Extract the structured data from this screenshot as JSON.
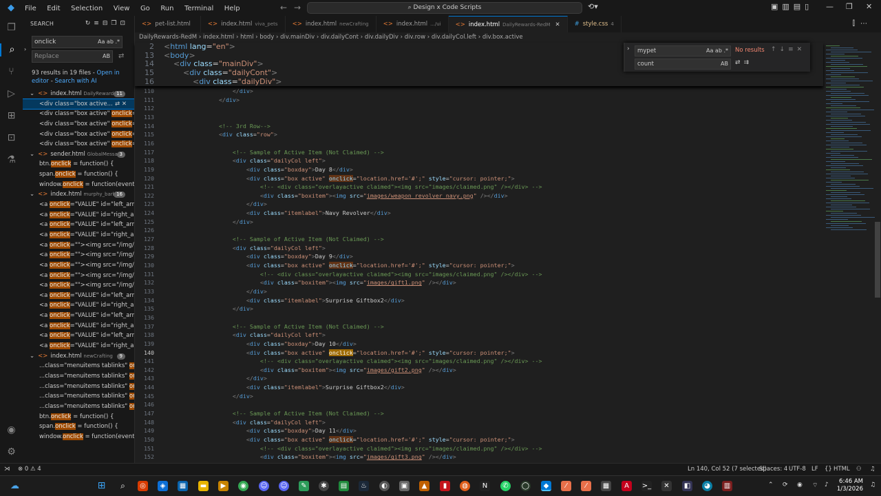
{
  "menu": [
    "File",
    "Edit",
    "Selection",
    "View",
    "Go",
    "Run",
    "Terminal",
    "Help"
  ],
  "command_center": "Design x Code Scripts",
  "sidebar": {
    "title": "SEARCH",
    "search_value": "onclick",
    "replace_placeholder": "Replace",
    "result_summary": "93 results in 19 files - ",
    "open_editor_link": "Open in editor",
    "search_ai_link": "Search with AI",
    "tree": [
      {
        "kind": "file",
        "name": "index.html",
        "dir": "DailyRewards-...",
        "count": "11"
      },
      {
        "kind": "match",
        "pre": "<div class=\"box active...",
        "hit": "",
        "post": "",
        "selected": true
      },
      {
        "kind": "match",
        "pre": "<div class=\"box active\" ",
        "hit": "onclick",
        "post": "=..."
      },
      {
        "kind": "match",
        "pre": "<div class=\"box active\" ",
        "hit": "onclick",
        "post": "=..."
      },
      {
        "kind": "match",
        "pre": "<div class=\"box active\" ",
        "hit": "onclick",
        "post": "=..."
      },
      {
        "kind": "match",
        "pre": "<div class=\"box active\" ",
        "hit": "onclick",
        "post": "=..."
      },
      {
        "kind": "file",
        "name": "sender.html",
        "dir": "GlobalMessage",
        "count": "3"
      },
      {
        "kind": "match",
        "pre": "btn.",
        "hit": "onclick",
        "post": " = function() {"
      },
      {
        "kind": "match",
        "pre": "span.",
        "hit": "onclick",
        "post": " = function() {"
      },
      {
        "kind": "match",
        "pre": "window.",
        "hit": "onclick",
        "post": " = function(event) {"
      },
      {
        "kind": "file",
        "name": "index.html",
        "dir": "murphy_barbe...",
        "count": "16"
      },
      {
        "kind": "match",
        "pre": "<a ",
        "hit": "onclick",
        "post": "=\"VALUE\" id=\"left_arro..."
      },
      {
        "kind": "match",
        "pre": "<a ",
        "hit": "onclick",
        "post": "=\"VALUE\" id=\"right_ar..."
      },
      {
        "kind": "match",
        "pre": "<a ",
        "hit": "onclick",
        "post": "=\"VALUE\" id=\"left_arro..."
      },
      {
        "kind": "match",
        "pre": "<a ",
        "hit": "onclick",
        "post": "=\"VALUE\" id=\"right_ar..."
      },
      {
        "kind": "match",
        "pre": "<a ",
        "hit": "onclick",
        "post": "=\"\"><img src=\"/img/..."
      },
      {
        "kind": "match",
        "pre": "<a ",
        "hit": "onclick",
        "post": "=\"\"><img src=\"/img/..."
      },
      {
        "kind": "match",
        "pre": "<a ",
        "hit": "onclick",
        "post": "=\"\"><img src=\"/img/..."
      },
      {
        "kind": "match",
        "pre": "<a ",
        "hit": "onclick",
        "post": "=\"\"><img src=\"/img/..."
      },
      {
        "kind": "match",
        "pre": "<a ",
        "hit": "onclick",
        "post": "=\"\"><img src=\"/img/..."
      },
      {
        "kind": "match",
        "pre": "<a ",
        "hit": "onclick",
        "post": "=\"VALUE\" id=\"left_arro..."
      },
      {
        "kind": "match",
        "pre": "<a ",
        "hit": "onclick",
        "post": "=\"VALUE\" id=\"right_ar..."
      },
      {
        "kind": "match",
        "pre": "<a ",
        "hit": "onclick",
        "post": "=\"VALUE\" id=\"left_arro..."
      },
      {
        "kind": "match",
        "pre": "<a ",
        "hit": "onclick",
        "post": "=\"VALUE\" id=\"right_ar..."
      },
      {
        "kind": "match",
        "pre": "<a ",
        "hit": "onclick",
        "post": "=\"VALUE\" id=\"left_arro..."
      },
      {
        "kind": "match",
        "pre": "<a ",
        "hit": "onclick",
        "post": "=\"VALUE\" id=\"right_ar..."
      },
      {
        "kind": "file",
        "name": "index.html",
        "dir": "newCrafting",
        "count": "9"
      },
      {
        "kind": "match",
        "pre": "...class=\"menuitems tablinks\" ",
        "hit": "on...",
        "post": ""
      },
      {
        "kind": "match",
        "pre": "...class=\"menuitems tablinks\" ",
        "hit": "on...",
        "post": ""
      },
      {
        "kind": "match",
        "pre": "...class=\"menuitems tablinks\" ",
        "hit": "on...",
        "post": ""
      },
      {
        "kind": "match",
        "pre": "...class=\"menuitems tablinks\" ",
        "hit": "on...",
        "post": ""
      },
      {
        "kind": "match",
        "pre": "...class=\"menuitems tablinks\" ",
        "hit": "on...",
        "post": ""
      },
      {
        "kind": "match",
        "pre": "btn.",
        "hit": "onclick",
        "post": " = function() {"
      },
      {
        "kind": "match",
        "pre": "span.",
        "hit": "onclick",
        "post": " = function() {"
      },
      {
        "kind": "match",
        "pre": "window.",
        "hit": "onclick",
        "post": " = function(event) {"
      }
    ]
  },
  "tabs": [
    {
      "name": "pet-list.html",
      "dir": "",
      "kind": "html",
      "active": false
    },
    {
      "name": "index.html",
      "dir": "viva_pets",
      "kind": "html",
      "active": false
    },
    {
      "name": "index.html",
      "dir": "newCrafting",
      "kind": "html",
      "active": false
    },
    {
      "name": "index.html",
      "dir": ".../ui",
      "kind": "html",
      "active": false
    },
    {
      "name": "index.html",
      "dir": "DailyRewards-RedM",
      "kind": "html",
      "active": true
    },
    {
      "name": "style.css",
      "dir": "4",
      "kind": "css",
      "active": false
    }
  ],
  "breadcrumb": [
    "DailyRewards-RedM",
    "index.html",
    "html",
    "body",
    "div.mainDiv",
    "div.dailyCont",
    "div.dailyDiv",
    "div.row",
    "div.dailyCol.left",
    "div.box.active"
  ],
  "find_widget": {
    "find_value": "mypet",
    "find_opts": "Aa ab .*",
    "no_results": "No results",
    "replace_value": "count"
  },
  "sticky_lines": [
    {
      "n": "2",
      "html": "<span class=\"p\">&lt;</span><span class=\"t\">html</span> <span class=\"a\">lang</span>=<span class=\"s\">\"en\"</span><span class=\"p\">&gt;</span>"
    },
    {
      "n": "13",
      "html": "<span class=\"p\">&lt;</span><span class=\"t\">body</span><span class=\"p\">&gt;</span>"
    },
    {
      "n": "14",
      "html": "    <span class=\"p\">&lt;</span><span class=\"t\">div</span> <span class=\"a\">class</span>=<span class=\"s\">\"mainDiv\"</span><span class=\"p\">&gt;</span>"
    },
    {
      "n": "15",
      "html": "        <span class=\"p\">&lt;</span><span class=\"t\">div</span> <span class=\"a\">class</span>=<span class=\"s\">\"dailyCont\"</span><span class=\"p\">&gt;</span>"
    },
    {
      "n": "16",
      "html": "            <span class=\"p\">&lt;</span><span class=\"t\">div</span> <span class=\"a\">class</span>=<span class=\"s\">\"dailyDiv\"</span><span class=\"p\">&gt;</span>"
    }
  ],
  "code_lines": [
    {
      "n": "110",
      "html": "                    <span class=\"p\">&lt;/</span><span class=\"t\">div</span><span class=\"p\">&gt;</span>"
    },
    {
      "n": "111",
      "html": "                <span class=\"p\">&lt;/</span><span class=\"t\">div</span><span class=\"p\">&gt;</span>"
    },
    {
      "n": "112",
      "html": ""
    },
    {
      "n": "113",
      "html": ""
    },
    {
      "n": "114",
      "html": "                <span class=\"c\">&lt;!-- 3rd Row--&gt;</span>"
    },
    {
      "n": "115",
      "html": "                <span class=\"p\">&lt;</span><span class=\"t\">div</span> <span class=\"a\">class</span>=<span class=\"s\">\"row\"</span><span class=\"p\">&gt;</span>"
    },
    {
      "n": "116",
      "html": ""
    },
    {
      "n": "117",
      "html": "                    <span class=\"c\">&lt;!-- Sample of Active Item (Not Claimed) --&gt;</span>"
    },
    {
      "n": "118",
      "html": "                    <span class=\"p\">&lt;</span><span class=\"t\">div</span> <span class=\"a\">class</span>=<span class=\"s\">\"dailyCol left\"</span><span class=\"p\">&gt;</span>"
    },
    {
      "n": "119",
      "html": "                        <span class=\"p\">&lt;</span><span class=\"t\">div</span> <span class=\"a\">class</span>=<span class=\"s\">\"boxday\"</span><span class=\"p\">&gt;</span><span class=\"w\">Day 8</span><span class=\"p\">&lt;/</span><span class=\"t\">div</span><span class=\"p\">&gt;</span>"
    },
    {
      "n": "120",
      "html": "                        <span class=\"p\">&lt;</span><span class=\"t\">div</span> <span class=\"a\">class</span>=<span class=\"s\">\"box active\"</span> <span class=\"a m\">onclick</span>=<span class=\"s\">\"location.href='#';\"</span> <span class=\"a\">style</span>=<span class=\"s\">\"cursor: pointer;\"</span><span class=\"p\">&gt;</span>"
    },
    {
      "n": "121",
      "html": "                            <span class=\"c\">&lt;!-- &lt;div class=\"overlayactive claimed\"&gt;&lt;img src=\"images/claimed.png\" /&gt;&lt;/div&gt; --&gt;</span>"
    },
    {
      "n": "122",
      "html": "                            <span class=\"p\">&lt;</span><span class=\"t\">div</span> <span class=\"a\">class</span>=<span class=\"s\">\"boxitem\"</span><span class=\"p\">&gt;&lt;</span><span class=\"t\">img</span> <span class=\"a\">src</span>=<span class=\"s\">\"<span class=\"u\">images/weapon_revolver_navy.png</span>\"</span> <span class=\"p\">/&gt;&lt;/</span><span class=\"t\">div</span><span class=\"p\">&gt;</span>"
    },
    {
      "n": "123",
      "html": "                        <span class=\"p\">&lt;/</span><span class=\"t\">div</span><span class=\"p\">&gt;</span>"
    },
    {
      "n": "124",
      "html": "                        <span class=\"p\">&lt;</span><span class=\"t\">div</span> <span class=\"a\">class</span>=<span class=\"s\">\"itemlabel\"</span><span class=\"p\">&gt;</span><span class=\"w\">Navy Revolver</span><span class=\"p\">&lt;/</span><span class=\"t\">div</span><span class=\"p\">&gt;</span>"
    },
    {
      "n": "125",
      "html": "                    <span class=\"p\">&lt;/</span><span class=\"t\">div</span><span class=\"p\">&gt;</span>"
    },
    {
      "n": "126",
      "html": ""
    },
    {
      "n": "127",
      "html": "                    <span class=\"c\">&lt;!-- Sample of Active Item (Not Claimed) --&gt;</span>"
    },
    {
      "n": "128",
      "html": "                    <span class=\"p\">&lt;</span><span class=\"t\">div</span> <span class=\"a\">class</span>=<span class=\"s\">\"dailyCol left\"</span><span class=\"p\">&gt;</span>"
    },
    {
      "n": "129",
      "html": "                        <span class=\"p\">&lt;</span><span class=\"t\">div</span> <span class=\"a\">class</span>=<span class=\"s\">\"boxday\"</span><span class=\"p\">&gt;</span><span class=\"w\">Day 9</span><span class=\"p\">&lt;/</span><span class=\"t\">div</span><span class=\"p\">&gt;</span>"
    },
    {
      "n": "130",
      "html": "                        <span class=\"p\">&lt;</span><span class=\"t\">div</span> <span class=\"a\">class</span>=<span class=\"s\">\"box active\"</span> <span class=\"a m\">onclick</span>=<span class=\"s\">\"location.href='#';\"</span> <span class=\"a\">style</span>=<span class=\"s\">\"cursor: pointer;\"</span><span class=\"p\">&gt;</span>"
    },
    {
      "n": "131",
      "html": "                            <span class=\"c\">&lt;!-- &lt;div class=\"overlayactive claimed\"&gt;&lt;img src=\"images/claimed.png\" /&gt;&lt;/div&gt; --&gt;</span>"
    },
    {
      "n": "132",
      "html": "                            <span class=\"p\">&lt;</span><span class=\"t\">div</span> <span class=\"a\">class</span>=<span class=\"s\">\"boxitem\"</span><span class=\"p\">&gt;&lt;</span><span class=\"t\">img</span> <span class=\"a\">src</span>=<span class=\"s\">\"<span class=\"u\">images/gift1.png</span>\"</span> <span class=\"p\">/&gt;&lt;/</span><span class=\"t\">div</span><span class=\"p\">&gt;</span>"
    },
    {
      "n": "133",
      "html": "                        <span class=\"p\">&lt;/</span><span class=\"t\">div</span><span class=\"p\">&gt;</span>"
    },
    {
      "n": "134",
      "html": "                        <span class=\"p\">&lt;</span><span class=\"t\">div</span> <span class=\"a\">class</span>=<span class=\"s\">\"itemlabel\"</span><span class=\"p\">&gt;</span><span class=\"w\">Surprise Giftbox2</span><span class=\"p\">&lt;/</span><span class=\"t\">div</span><span class=\"p\">&gt;</span>"
    },
    {
      "n": "135",
      "html": "                    <span class=\"p\">&lt;/</span><span class=\"t\">div</span><span class=\"p\">&gt;</span>"
    },
    {
      "n": "136",
      "html": ""
    },
    {
      "n": "137",
      "html": "                    <span class=\"c\">&lt;!-- Sample of Active Item (Not Claimed) --&gt;</span>"
    },
    {
      "n": "138",
      "html": "                    <span class=\"p\">&lt;</span><span class=\"t\">div</span> <span class=\"a\">class</span>=<span class=\"s\">\"dailyCol left\"</span><span class=\"p\">&gt;</span>"
    },
    {
      "n": "139",
      "html": "                        <span class=\"p\">&lt;</span><span class=\"t\">div</span> <span class=\"a\">class</span>=<span class=\"s\">\"boxday\"</span><span class=\"p\">&gt;</span><span class=\"w\">Day 10</span><span class=\"p\">&lt;/</span><span class=\"t\">div</span><span class=\"p\">&gt;</span>"
    },
    {
      "n": "140",
      "cur": true,
      "html": "                        <span class=\"p\">&lt;</span><span class=\"t\">div</span> <span class=\"a\">class</span>=<span class=\"s\">\"box active\"</span> <span class=\"mc\">onclick</span>=<span class=\"s\">\"location.href='#';\"</span> <span class=\"a\">style</span>=<span class=\"s\">\"cursor: pointer;\"</span><span class=\"p\">&gt;</span>"
    },
    {
      "n": "141",
      "html": "                            <span class=\"c\">&lt;!-- &lt;div class=\"overlayactive claimed\"&gt;&lt;img src=\"images/claimed.png\" /&gt;&lt;/div&gt; --&gt;</span>"
    },
    {
      "n": "142",
      "html": "                            <span class=\"p\">&lt;</span><span class=\"t\">div</span> <span class=\"a\">class</span>=<span class=\"s\">\"boxitem\"</span><span class=\"p\">&gt;&lt;</span><span class=\"t\">img</span> <span class=\"a\">src</span>=<span class=\"s\">\"<span class=\"u\">images/gift2.png</span>\"</span> <span class=\"p\">/&gt;&lt;/</span><span class=\"t\">div</span><span class=\"p\">&gt;</span>"
    },
    {
      "n": "143",
      "html": "                        <span class=\"p\">&lt;/</span><span class=\"t\">div</span><span class=\"p\">&gt;</span>"
    },
    {
      "n": "144",
      "html": "                        <span class=\"p\">&lt;</span><span class=\"t\">div</span> <span class=\"a\">class</span>=<span class=\"s\">\"itemlabel\"</span><span class=\"p\">&gt;</span><span class=\"w\">Surprise Giftbox2</span><span class=\"p\">&lt;/</span><span class=\"t\">div</span><span class=\"p\">&gt;</span>"
    },
    {
      "n": "145",
      "html": "                    <span class=\"p\">&lt;/</span><span class=\"t\">div</span><span class=\"p\">&gt;</span>"
    },
    {
      "n": "146",
      "html": ""
    },
    {
      "n": "147",
      "html": "                    <span class=\"c\">&lt;!-- Sample of Active Item (Not Claimed) --&gt;</span>"
    },
    {
      "n": "148",
      "html": "                    <span class=\"p\">&lt;</span><span class=\"t\">div</span> <span class=\"a\">class</span>=<span class=\"s\">\"dailyCol left\"</span><span class=\"p\">&gt;</span>"
    },
    {
      "n": "149",
      "html": "                        <span class=\"p\">&lt;</span><span class=\"t\">div</span> <span class=\"a\">class</span>=<span class=\"s\">\"boxday\"</span><span class=\"p\">&gt;</span><span class=\"w\">Day 11</span><span class=\"p\">&lt;/</span><span class=\"t\">div</span><span class=\"p\">&gt;</span>"
    },
    {
      "n": "150",
      "html": "                        <span class=\"p\">&lt;</span><span class=\"t\">div</span> <span class=\"a\">class</span>=<span class=\"s\">\"box active\"</span> <span class=\"a m\">onclick</span>=<span class=\"s\">\"location.href='#';\"</span> <span class=\"a\">style</span>=<span class=\"s\">\"cursor: pointer;\"</span><span class=\"p\">&gt;</span>"
    },
    {
      "n": "151",
      "html": "                            <span class=\"c\">&lt;!-- &lt;div class=\"overlayactive claimed\"&gt;&lt;img src=\"images/claimed.png\" /&gt;&lt;/div&gt; --&gt;</span>"
    },
    {
      "n": "152",
      "html": "                            <span class=\"p\">&lt;</span><span class=\"t\">div</span> <span class=\"a\">class</span>=<span class=\"s\">\"boxitem\"</span><span class=\"p\">&gt;&lt;</span><span class=\"t\">img</span> <span class=\"a\">src</span>=<span class=\"s\">\"<span class=\"u\">images/gift3.png</span>\"</span> <span class=\"p\">/&gt;&lt;/</span><span class=\"t\">div</span><span class=\"p\">&gt;</span>"
    },
    {
      "n": "153",
      "html": "                        <span class=\"p\">&lt;/</span><span class=\"t\">div</span><span class=\"p\">&gt;</span>"
    }
  ],
  "status": {
    "problems": "0",
    "warnings": "4",
    "position": "Ln 140, Col 52 (7 selected)",
    "spaces": "Spaces: 4",
    "encoding": "UTF-8",
    "eol": "LF",
    "language": "HTML"
  },
  "taskbar": {
    "time": "6:46 AM",
    "date": "1/3/2026"
  },
  "colors": {
    "accent": "#0078d4",
    "match_highlight": "#9e4a00",
    "no_results": "#f48771"
  }
}
